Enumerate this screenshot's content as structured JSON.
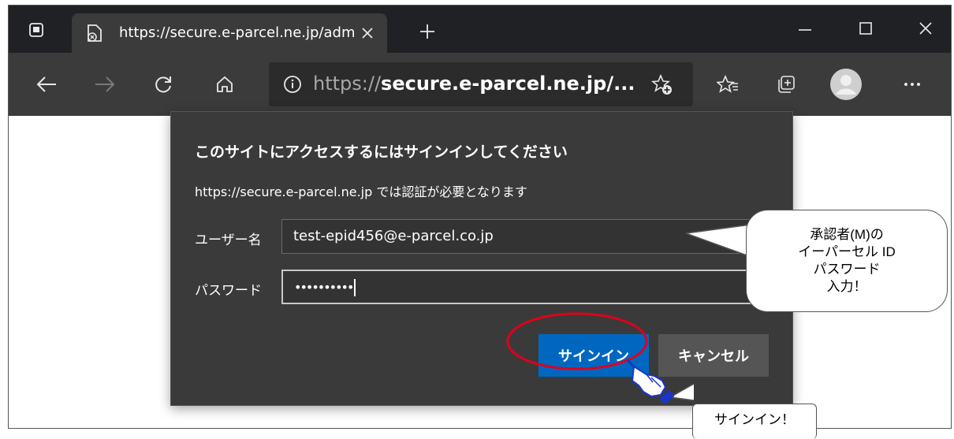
{
  "tab": {
    "title": "https://secure.e-parcel.ne.jp/adm"
  },
  "address_bar": {
    "prefix": "https://",
    "host": "secure.e-parcel.ne.jp/..."
  },
  "dialog": {
    "title": "このサイトにアクセスするにはサインインしてください",
    "message": "https://secure.e-parcel.ne.jp では認証が必要となります",
    "username_label": "ユーザー名",
    "username_value": "test-epid456@e-parcel.co.jp",
    "password_label": "パスワード",
    "password_value": "••••••••••",
    "signin_label": "サインイン",
    "cancel_label": "キャンセル"
  },
  "callouts": {
    "credentials": [
      "承認者(M)の",
      "イーパーセル ID",
      "パスワード",
      "入力！"
    ],
    "signin": "サインイン！"
  },
  "icons": [
    "tab-actions-icon",
    "site-icon",
    "close-tab-icon",
    "new-tab-icon",
    "minimize-icon",
    "maximize-icon",
    "close-window-icon",
    "back-icon",
    "forward-icon",
    "refresh-icon",
    "home-icon",
    "info-icon",
    "add-favorite-icon",
    "favorites-icon",
    "collections-icon",
    "profile-icon",
    "more-icon",
    "pointing-hand-icon"
  ],
  "colors": {
    "accent": "#0067c0",
    "dialog_bg": "#3a3a3a",
    "highlight": "#e0001b",
    "hand": "#1a35c8"
  }
}
